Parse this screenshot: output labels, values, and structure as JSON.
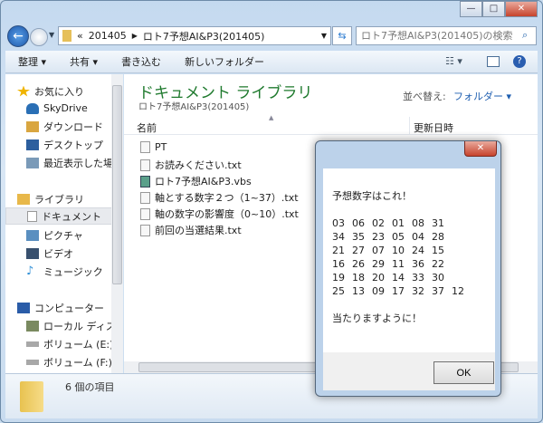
{
  "window": {
    "min": "—",
    "max": "□",
    "close": "✕"
  },
  "address": {
    "overflow": "«",
    "segments": [
      "201405",
      "ロト7予想AI&P3(201405)"
    ],
    "search_placeholder": "ロト7予想AI&P3(201405)の検索"
  },
  "toolbar": {
    "organize": "整理 ▾",
    "share": "共有 ▾",
    "burn": "書き込む",
    "new_folder": "新しいフォルダー"
  },
  "nav": {
    "items": [
      {
        "label": "お気に入り",
        "icon": "star-icon",
        "color": "#f0b400"
      },
      {
        "label": "SkyDrive",
        "icon": "skydrive-icon",
        "color": "#2a6fb5"
      },
      {
        "label": "ダウンロード",
        "icon": "download-folder-icon",
        "color": "#d9a640"
      },
      {
        "label": "デスクトップ",
        "icon": "desktop-icon",
        "color": "#2d5f9e"
      },
      {
        "label": "最近表示した場所",
        "icon": "recent-places-icon",
        "color": "#7a9ab8"
      },
      {
        "label": "ライブラリ",
        "icon": "library-icon",
        "color": "#e8b84a"
      },
      {
        "label": "ドキュメント",
        "icon": "document-icon",
        "color": "#d8dde4"
      },
      {
        "label": "ピクチャ",
        "icon": "picture-icon",
        "color": "#5a8fc0"
      },
      {
        "label": "ビデオ",
        "icon": "video-icon",
        "color": "#38506e"
      },
      {
        "label": "ミュージック",
        "icon": "music-icon",
        "color": "#2f8fd6"
      },
      {
        "label": "コンピューター",
        "icon": "computer-icon",
        "color": "#2a5ca8"
      },
      {
        "label": "ローカル ディスク",
        "icon": "local-disk-icon",
        "color": "#7a8a60"
      },
      {
        "label": "ボリューム (E:)",
        "icon": "drive-icon",
        "color": "#a8a8a8"
      },
      {
        "label": "ボリューム (F:)",
        "icon": "drive-icon",
        "color": "#a8a8a8"
      }
    ]
  },
  "main": {
    "title": "ドキュメント ライブラリ",
    "subtitle": "ロト7予想AI&P3(201405)",
    "sort_label": "並べ替え:",
    "sort_value": "フォルダー ▾",
    "col_name": "名前",
    "col_date": "更新日時",
    "files": [
      {
        "name": "PT",
        "icon": "file-icon"
      },
      {
        "name": "お読みください.txt",
        "icon": "text-file-icon"
      },
      {
        "name": "ロト7予想AI&P3.vbs",
        "icon": "vbs-script-icon"
      },
      {
        "name": "軸とする数字２つ（1~37）.txt",
        "icon": "text-file-icon"
      },
      {
        "name": "軸の数字の影響度（0~10）.txt",
        "icon": "text-file-icon"
      },
      {
        "name": "前回の当選結果.txt",
        "icon": "text-file-icon"
      }
    ]
  },
  "status": {
    "count": "6 個の項目"
  },
  "dialog": {
    "close": "✕",
    "heading": "予想数字はこれ！",
    "rows": [
      [
        "03",
        "06",
        "02",
        "01",
        "08",
        "31"
      ],
      [
        "34",
        "35",
        "23",
        "05",
        "04",
        "28"
      ],
      [
        "21",
        "27",
        "07",
        "10",
        "24",
        "15"
      ],
      [
        "16",
        "26",
        "29",
        "11",
        "36",
        "22"
      ],
      [
        "19",
        "18",
        "20",
        "14",
        "33",
        "30"
      ],
      [
        "25",
        "13",
        "09",
        "17",
        "32",
        "37",
        "12"
      ]
    ],
    "footer_text": "当たりますように！",
    "ok": "OK"
  }
}
